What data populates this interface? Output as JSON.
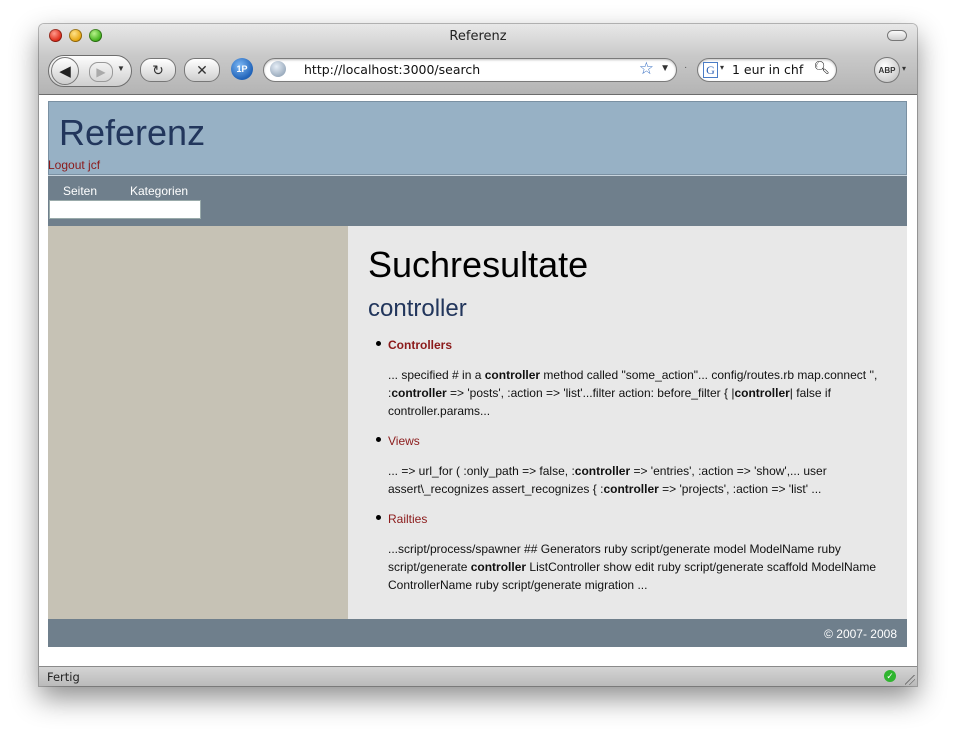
{
  "window": {
    "title": "Referenz",
    "status_text": "Fertig"
  },
  "toolbar": {
    "back_icon": "back-arrow-icon",
    "forward_icon": "forward-arrow-icon",
    "reload_icon": "reload-icon",
    "stop_icon": "stop-icon",
    "onepassword_label": "1P",
    "url": "http://localhost:3000/search",
    "search_engine_icon": "G",
    "search_value": "1 eur in chf",
    "adblock_label": "ABP"
  },
  "site": {
    "logo": "Referenz",
    "logout_link": "Logout jcf",
    "nav": [
      {
        "label": "Seiten"
      },
      {
        "label": "Kategorien"
      }
    ],
    "nav_search_value": "",
    "footer": "© 2007- 2008"
  },
  "content": {
    "title": "Suchresultate",
    "query": "controller",
    "results": [
      {
        "title": "Controllers",
        "bold_title": true,
        "snippet_html": "... specified # in a <b>controller</b> method called \"some_action\"... config/routes.rb map.connect '', :<b>controller</b> => 'posts', :action => 'list'...filter action: before_filter { |<b>controller</b>| false if controller.params..."
      },
      {
        "title": "Views",
        "bold_title": false,
        "snippet_html": "... => url_for ( :only_path => false, :<b>controller</b> => 'entries', :action => 'show',... user assert\\_recognizes assert_recognizes { :<b>controller</b> => 'projects', :action => 'list' ..."
      },
      {
        "title": "Railties",
        "bold_title": false,
        "snippet_html": "...script/process/spawner ## Generators ruby script/generate model ModelName ruby script/generate <b>controller</b> ListController show edit ruby script/generate scaffold ModelName ControllerName ruby script/generate migration ..."
      }
    ]
  },
  "colors": {
    "header_bg": "#97b1c5",
    "nav_bg": "#6f7f8c",
    "sidebar_bg": "#c6c2b5",
    "content_bg": "#e8e8e8",
    "link": "#8b1a1a",
    "logo": "#22365c"
  }
}
